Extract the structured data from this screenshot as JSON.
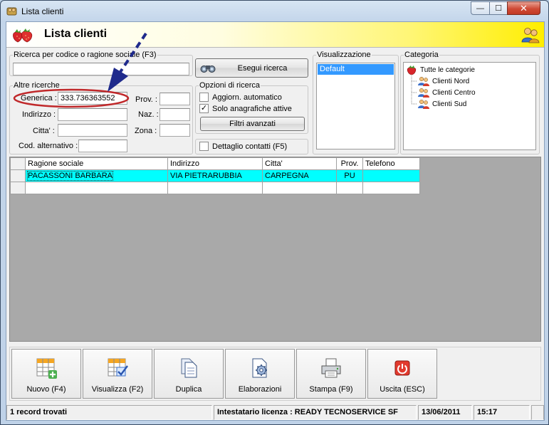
{
  "window": {
    "title": "Lista clienti",
    "buttons": {
      "minimize": "—",
      "maximize": "☐",
      "close": "✕"
    }
  },
  "header": {
    "title": "Lista clienti",
    "logo_icon": "strawberry-icon",
    "right_icon": "users-icon"
  },
  "search": {
    "code_group_label": "Ricerca per codice o ragione sociale (F3)",
    "code_value": "",
    "execute_button": "Esegui ricerca",
    "other_group_label": "Altre ricerche",
    "fields": {
      "generica_label": "Generica :",
      "generica_value": "333.736363552",
      "indirizzo_label": "Indirizzo :",
      "indirizzo_value": "",
      "citta_label": "Citta' :",
      "citta_value": "",
      "cod_alt_label": "Cod. alternativo :",
      "cod_alt_value": "",
      "prov_label": "Prov. :",
      "prov_value": "",
      "naz_label": "Naz. :",
      "naz_value": "",
      "zona_label": "Zona :",
      "zona_value": ""
    }
  },
  "options": {
    "group_label": "Opzioni di ricerca",
    "auto_update_label": "Aggiorn. automatico",
    "auto_update_checked": false,
    "active_only_label": "Solo anagrafiche attive",
    "active_only_checked": true,
    "advanced_filters_button": "Filtri avanzati",
    "contact_details_label": "Dettaglio contatti (F5)",
    "contact_details_checked": false
  },
  "view": {
    "group_label": "Visualizzazione",
    "items": [
      "Default"
    ],
    "selected": "Default"
  },
  "category": {
    "group_label": "Categoria",
    "root": "Tutte le categorie",
    "children": [
      "Clienti Nord",
      "Clienti Centro",
      "Clienti Sud"
    ]
  },
  "grid": {
    "columns": [
      "Ragione sociale",
      "Indirizzo",
      "Citta'",
      "Prov.",
      "Telefono"
    ],
    "rows": [
      [
        "PACASSONI BARBARA",
        "VIA PIETRARUBBIA",
        "CARPEGNA",
        "PU",
        ""
      ]
    ]
  },
  "toolbar": {
    "new_label": "Nuovo (F4)",
    "view_label": "Visualizza (F2)",
    "duplicate_label": "Duplica",
    "process_label": "Elaborazioni",
    "print_label": "Stampa (F9)",
    "exit_label": "Uscita (ESC)"
  },
  "status": {
    "records": "1 record trovati",
    "license": "Intestatario licenza : READY TECNOSERVICE SF",
    "date": "13/06/2011",
    "time": "15:17"
  },
  "colors": {
    "row_highlight": "#00ffff",
    "selection": "#3399ff",
    "annotation_arrow": "#1f2a8c",
    "annotation_circle": "#c0282a"
  }
}
